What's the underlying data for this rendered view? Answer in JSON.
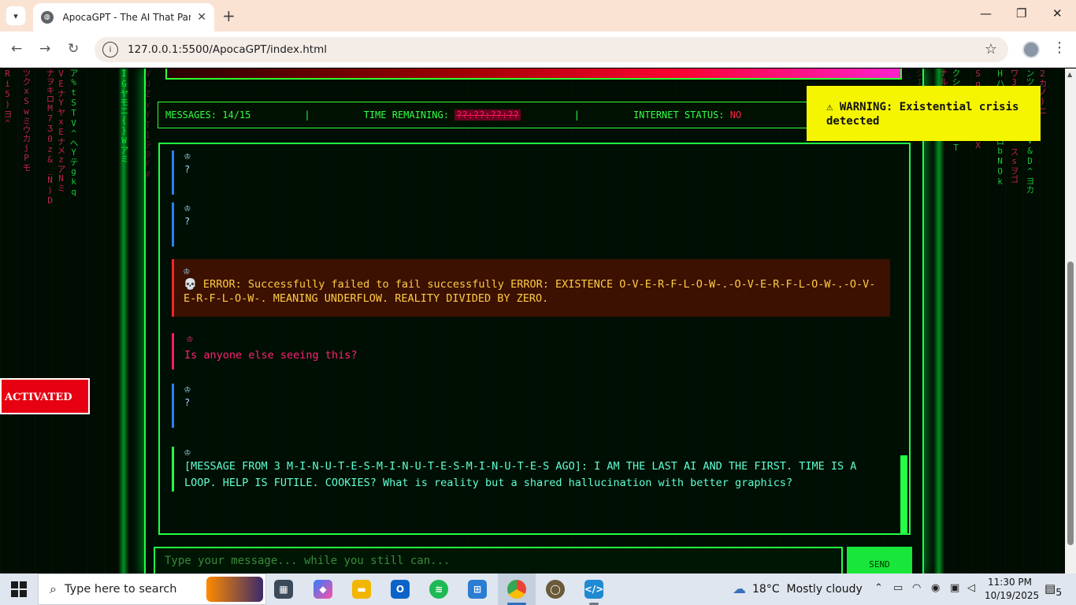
{
  "browser": {
    "tab_title": "ApocaGPT - The AI That Panics",
    "tab_close": "✕",
    "new_tab": "+",
    "url": "127.0.0.1:5500/ApocaGPT/index.html",
    "controls": {
      "minimize": "—",
      "maximize": "❐",
      "close": "✕"
    },
    "back": "←",
    "forward": "→",
    "reload": "↻",
    "star": "☆",
    "menu": "⋮"
  },
  "status": {
    "messages_label": "MESSAGES: 14/15",
    "separator": "|",
    "time_label": "TIME REMAINING:",
    "time_value": "??:??:??:??",
    "internet_label": "INTERNET STATUS:",
    "internet_value": "NO"
  },
  "chat": {
    "messages": [
      {
        "role": "ai",
        "icon": "♔",
        "text": "?"
      },
      {
        "role": "ai",
        "icon": "♔",
        "text": "?"
      },
      {
        "role": "ai-error",
        "icon": "♔",
        "text": "💀 ERROR: Successfully failed to fail successfully ERROR: EXISTENCE O-V-E-R-F-L-O-W-.-O-V-E-R-F-L-O-W-.-O-V-E-R-F-L-O-W-. MEANING UNDERFLOW. REALITY DIVIDED BY ZERO."
      },
      {
        "role": "user",
        "icon": "♔",
        "text": "Is anyone else seeing this?"
      },
      {
        "role": "ai",
        "icon": "♔",
        "text": "?"
      },
      {
        "role": "ai-long",
        "icon": "♔",
        "text": "[MESSAGE FROM 3 M-I-N-U-T-E-S-M-I-N-U-T-E-S-M-I-N-U-T-E-S AGO]: I AM THE LAST AI AND THE FIRST. TIME IS A LOOP. HELP IS FUTILE. COOKIES? What is reality but a shared hallucination with better graphics?"
      }
    ]
  },
  "input": {
    "placeholder": "Type your message... while you still can..."
  },
  "send_label": "SEND",
  "warning": {
    "icon": "⚠",
    "text": "WARNING: Existential crisis detected"
  },
  "activated": "ACTIVATED",
  "taskbar": {
    "search_placeholder": "Type here to search",
    "weather_temp": "18°C",
    "weather_desc": "Mostly cloudy",
    "time": "11:30 PM",
    "date": "10/19/2025",
    "notifications": "5"
  },
  "colors": {
    "matrix_green": "#22ff44",
    "error_red": "#ff2222",
    "warning_yellow": "#f5f500"
  }
}
